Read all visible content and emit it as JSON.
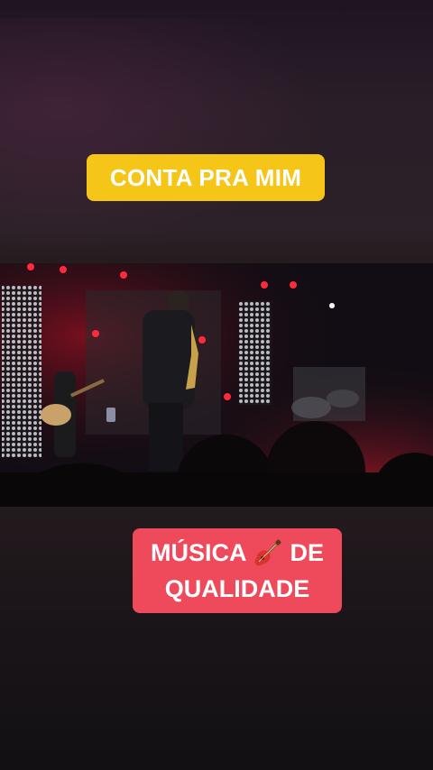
{
  "captions": {
    "top": "CONTA PRA MIM",
    "bottom_line1_start": "MÚSICA",
    "bottom_line1_end": "DE",
    "bottom_line2": "QUALIDADE"
  },
  "icons": {
    "guitar": "guitar-icon"
  },
  "colors": {
    "top_caption_bg": "#f5c518",
    "bottom_caption_bg": "#ef4a5c",
    "caption_text": "#ffffff"
  }
}
